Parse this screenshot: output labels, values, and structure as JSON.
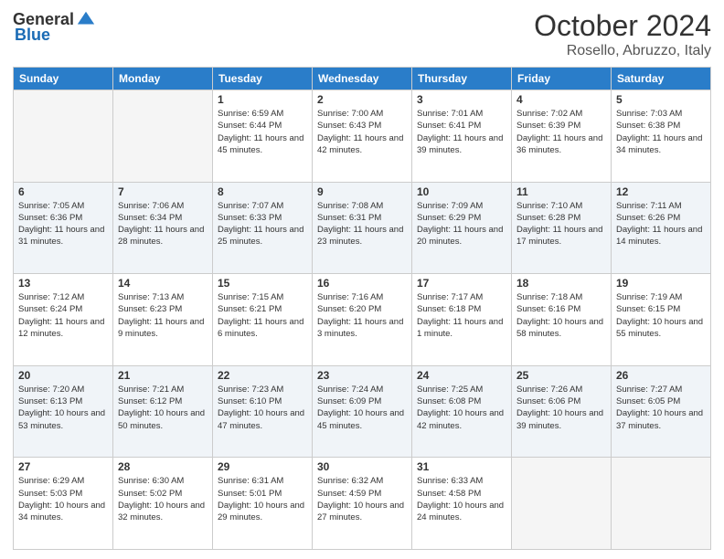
{
  "header": {
    "logo_general": "General",
    "logo_blue": "Blue",
    "month": "October 2024",
    "location": "Rosello, Abruzzo, Italy"
  },
  "weekdays": [
    "Sunday",
    "Monday",
    "Tuesday",
    "Wednesday",
    "Thursday",
    "Friday",
    "Saturday"
  ],
  "weeks": [
    [
      {
        "day": "",
        "sunrise": "",
        "sunset": "",
        "daylight": "",
        "empty": true
      },
      {
        "day": "",
        "sunrise": "",
        "sunset": "",
        "daylight": "",
        "empty": true
      },
      {
        "day": "1",
        "sunrise": "Sunrise: 6:59 AM",
        "sunset": "Sunset: 6:44 PM",
        "daylight": "Daylight: 11 hours and 45 minutes.",
        "empty": false
      },
      {
        "day": "2",
        "sunrise": "Sunrise: 7:00 AM",
        "sunset": "Sunset: 6:43 PM",
        "daylight": "Daylight: 11 hours and 42 minutes.",
        "empty": false
      },
      {
        "day": "3",
        "sunrise": "Sunrise: 7:01 AM",
        "sunset": "Sunset: 6:41 PM",
        "daylight": "Daylight: 11 hours and 39 minutes.",
        "empty": false
      },
      {
        "day": "4",
        "sunrise": "Sunrise: 7:02 AM",
        "sunset": "Sunset: 6:39 PM",
        "daylight": "Daylight: 11 hours and 36 minutes.",
        "empty": false
      },
      {
        "day": "5",
        "sunrise": "Sunrise: 7:03 AM",
        "sunset": "Sunset: 6:38 PM",
        "daylight": "Daylight: 11 hours and 34 minutes.",
        "empty": false
      }
    ],
    [
      {
        "day": "6",
        "sunrise": "Sunrise: 7:05 AM",
        "sunset": "Sunset: 6:36 PM",
        "daylight": "Daylight: 11 hours and 31 minutes.",
        "empty": false
      },
      {
        "day": "7",
        "sunrise": "Sunrise: 7:06 AM",
        "sunset": "Sunset: 6:34 PM",
        "daylight": "Daylight: 11 hours and 28 minutes.",
        "empty": false
      },
      {
        "day": "8",
        "sunrise": "Sunrise: 7:07 AM",
        "sunset": "Sunset: 6:33 PM",
        "daylight": "Daylight: 11 hours and 25 minutes.",
        "empty": false
      },
      {
        "day": "9",
        "sunrise": "Sunrise: 7:08 AM",
        "sunset": "Sunset: 6:31 PM",
        "daylight": "Daylight: 11 hours and 23 minutes.",
        "empty": false
      },
      {
        "day": "10",
        "sunrise": "Sunrise: 7:09 AM",
        "sunset": "Sunset: 6:29 PM",
        "daylight": "Daylight: 11 hours and 20 minutes.",
        "empty": false
      },
      {
        "day": "11",
        "sunrise": "Sunrise: 7:10 AM",
        "sunset": "Sunset: 6:28 PM",
        "daylight": "Daylight: 11 hours and 17 minutes.",
        "empty": false
      },
      {
        "day": "12",
        "sunrise": "Sunrise: 7:11 AM",
        "sunset": "Sunset: 6:26 PM",
        "daylight": "Daylight: 11 hours and 14 minutes.",
        "empty": false
      }
    ],
    [
      {
        "day": "13",
        "sunrise": "Sunrise: 7:12 AM",
        "sunset": "Sunset: 6:24 PM",
        "daylight": "Daylight: 11 hours and 12 minutes.",
        "empty": false
      },
      {
        "day": "14",
        "sunrise": "Sunrise: 7:13 AM",
        "sunset": "Sunset: 6:23 PM",
        "daylight": "Daylight: 11 hours and 9 minutes.",
        "empty": false
      },
      {
        "day": "15",
        "sunrise": "Sunrise: 7:15 AM",
        "sunset": "Sunset: 6:21 PM",
        "daylight": "Daylight: 11 hours and 6 minutes.",
        "empty": false
      },
      {
        "day": "16",
        "sunrise": "Sunrise: 7:16 AM",
        "sunset": "Sunset: 6:20 PM",
        "daylight": "Daylight: 11 hours and 3 minutes.",
        "empty": false
      },
      {
        "day": "17",
        "sunrise": "Sunrise: 7:17 AM",
        "sunset": "Sunset: 6:18 PM",
        "daylight": "Daylight: 11 hours and 1 minute.",
        "empty": false
      },
      {
        "day": "18",
        "sunrise": "Sunrise: 7:18 AM",
        "sunset": "Sunset: 6:16 PM",
        "daylight": "Daylight: 10 hours and 58 minutes.",
        "empty": false
      },
      {
        "day": "19",
        "sunrise": "Sunrise: 7:19 AM",
        "sunset": "Sunset: 6:15 PM",
        "daylight": "Daylight: 10 hours and 55 minutes.",
        "empty": false
      }
    ],
    [
      {
        "day": "20",
        "sunrise": "Sunrise: 7:20 AM",
        "sunset": "Sunset: 6:13 PM",
        "daylight": "Daylight: 10 hours and 53 minutes.",
        "empty": false
      },
      {
        "day": "21",
        "sunrise": "Sunrise: 7:21 AM",
        "sunset": "Sunset: 6:12 PM",
        "daylight": "Daylight: 10 hours and 50 minutes.",
        "empty": false
      },
      {
        "day": "22",
        "sunrise": "Sunrise: 7:23 AM",
        "sunset": "Sunset: 6:10 PM",
        "daylight": "Daylight: 10 hours and 47 minutes.",
        "empty": false
      },
      {
        "day": "23",
        "sunrise": "Sunrise: 7:24 AM",
        "sunset": "Sunset: 6:09 PM",
        "daylight": "Daylight: 10 hours and 45 minutes.",
        "empty": false
      },
      {
        "day": "24",
        "sunrise": "Sunrise: 7:25 AM",
        "sunset": "Sunset: 6:08 PM",
        "daylight": "Daylight: 10 hours and 42 minutes.",
        "empty": false
      },
      {
        "day": "25",
        "sunrise": "Sunrise: 7:26 AM",
        "sunset": "Sunset: 6:06 PM",
        "daylight": "Daylight: 10 hours and 39 minutes.",
        "empty": false
      },
      {
        "day": "26",
        "sunrise": "Sunrise: 7:27 AM",
        "sunset": "Sunset: 6:05 PM",
        "daylight": "Daylight: 10 hours and 37 minutes.",
        "empty": false
      }
    ],
    [
      {
        "day": "27",
        "sunrise": "Sunrise: 6:29 AM",
        "sunset": "Sunset: 5:03 PM",
        "daylight": "Daylight: 10 hours and 34 minutes.",
        "empty": false
      },
      {
        "day": "28",
        "sunrise": "Sunrise: 6:30 AM",
        "sunset": "Sunset: 5:02 PM",
        "daylight": "Daylight: 10 hours and 32 minutes.",
        "empty": false
      },
      {
        "day": "29",
        "sunrise": "Sunrise: 6:31 AM",
        "sunset": "Sunset: 5:01 PM",
        "daylight": "Daylight: 10 hours and 29 minutes.",
        "empty": false
      },
      {
        "day": "30",
        "sunrise": "Sunrise: 6:32 AM",
        "sunset": "Sunset: 4:59 PM",
        "daylight": "Daylight: 10 hours and 27 minutes.",
        "empty": false
      },
      {
        "day": "31",
        "sunrise": "Sunrise: 6:33 AM",
        "sunset": "Sunset: 4:58 PM",
        "daylight": "Daylight: 10 hours and 24 minutes.",
        "empty": false
      },
      {
        "day": "",
        "sunrise": "",
        "sunset": "",
        "daylight": "",
        "empty": true
      },
      {
        "day": "",
        "sunrise": "",
        "sunset": "",
        "daylight": "",
        "empty": true
      }
    ]
  ]
}
